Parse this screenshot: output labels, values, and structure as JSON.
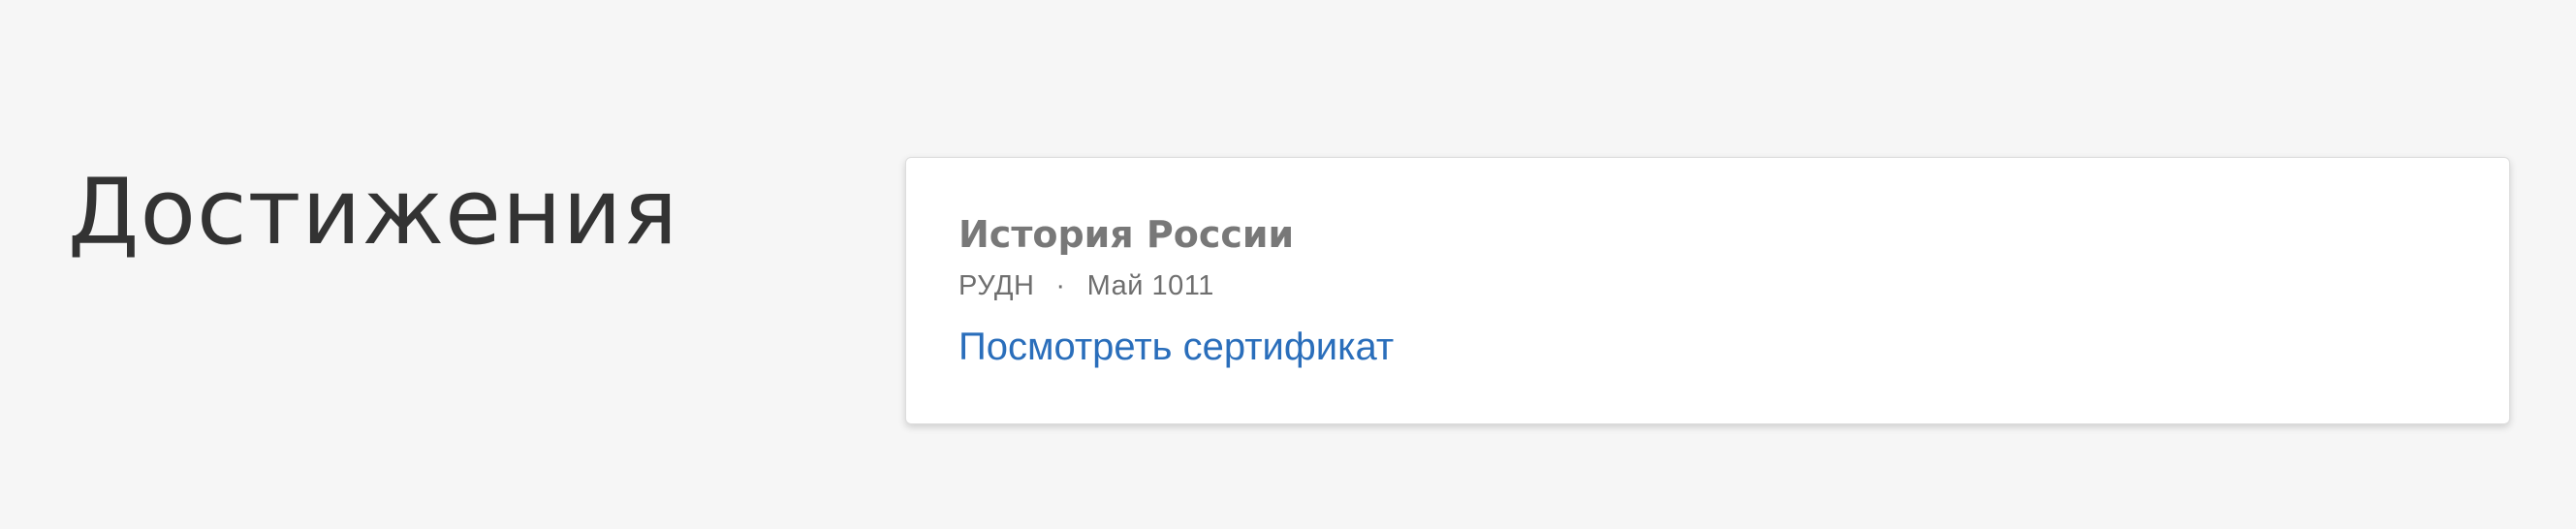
{
  "section": {
    "title": "Достижения"
  },
  "achievements": [
    {
      "title": "История России",
      "issuer": "РУДН",
      "separator": "·",
      "date": "Май 1011",
      "link_label": "Посмотреть сертификат"
    }
  ],
  "colors": {
    "background": "#f6f6f6",
    "card_background": "#ffffff",
    "title_text": "#333333",
    "card_title_text": "#787878",
    "meta_text": "#6f6f6f",
    "link": "#2a6ebb"
  }
}
